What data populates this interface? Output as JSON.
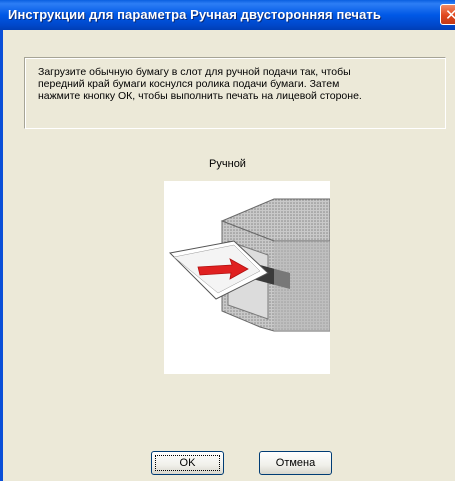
{
  "window": {
    "title": "Инструкции для параметра Ручная двусторонняя печать"
  },
  "instructions": "Загрузите обычную бумагу в слот для ручной подачи так, чтобы\nпередний край бумаги коснулся ролика подачи бумаги. Затем\nнажмите кнопку ОК, чтобы выполнить печать на лицевой стороне.",
  "illustration": {
    "label": "Ручной"
  },
  "buttons": {
    "ok": "OK",
    "cancel": "Отмена"
  },
  "colors": {
    "titlebar": "#0058e6",
    "close": "#e0461c",
    "arrow": "#e02020"
  }
}
